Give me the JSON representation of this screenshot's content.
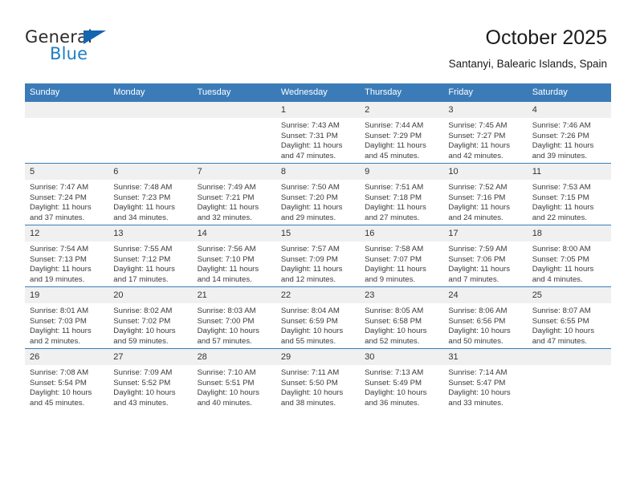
{
  "brand": {
    "line1": "General",
    "line2": "Blue",
    "flag_icon": "blue-triangle-flag-icon",
    "colors": {
      "general": "#2b2b2b",
      "blue": "#1f7ec4",
      "flag": "#1565b0"
    }
  },
  "header": {
    "month_title": "October 2025",
    "location": "Santanyi, Balearic Islands, Spain"
  },
  "theme": {
    "header_row_background": "#3b7cb8",
    "header_row_text": "#ffffff",
    "daynum_background": "#f0f0f0",
    "row_separator": "#3b7cb8",
    "body_text": "#3a3a3a"
  },
  "labels": {
    "sunrise_prefix": "Sunrise:",
    "sunset_prefix": "Sunset:",
    "daylight_prefix": "Daylight:"
  },
  "columns": [
    "Sunday",
    "Monday",
    "Tuesday",
    "Wednesday",
    "Thursday",
    "Friday",
    "Saturday"
  ],
  "weeks": [
    [
      {
        "day": "",
        "empty": true
      },
      {
        "day": "",
        "empty": true
      },
      {
        "day": "",
        "empty": true
      },
      {
        "day": "1",
        "sunrise": "Sunrise: 7:43 AM",
        "sunset": "Sunset: 7:31 PM",
        "daylight": "Daylight: 11 hours and 47 minutes."
      },
      {
        "day": "2",
        "sunrise": "Sunrise: 7:44 AM",
        "sunset": "Sunset: 7:29 PM",
        "daylight": "Daylight: 11 hours and 45 minutes."
      },
      {
        "day": "3",
        "sunrise": "Sunrise: 7:45 AM",
        "sunset": "Sunset: 7:27 PM",
        "daylight": "Daylight: 11 hours and 42 minutes."
      },
      {
        "day": "4",
        "sunrise": "Sunrise: 7:46 AM",
        "sunset": "Sunset: 7:26 PM",
        "daylight": "Daylight: 11 hours and 39 minutes."
      }
    ],
    [
      {
        "day": "5",
        "sunrise": "Sunrise: 7:47 AM",
        "sunset": "Sunset: 7:24 PM",
        "daylight": "Daylight: 11 hours and 37 minutes."
      },
      {
        "day": "6",
        "sunrise": "Sunrise: 7:48 AM",
        "sunset": "Sunset: 7:23 PM",
        "daylight": "Daylight: 11 hours and 34 minutes."
      },
      {
        "day": "7",
        "sunrise": "Sunrise: 7:49 AM",
        "sunset": "Sunset: 7:21 PM",
        "daylight": "Daylight: 11 hours and 32 minutes."
      },
      {
        "day": "8",
        "sunrise": "Sunrise: 7:50 AM",
        "sunset": "Sunset: 7:20 PM",
        "daylight": "Daylight: 11 hours and 29 minutes."
      },
      {
        "day": "9",
        "sunrise": "Sunrise: 7:51 AM",
        "sunset": "Sunset: 7:18 PM",
        "daylight": "Daylight: 11 hours and 27 minutes."
      },
      {
        "day": "10",
        "sunrise": "Sunrise: 7:52 AM",
        "sunset": "Sunset: 7:16 PM",
        "daylight": "Daylight: 11 hours and 24 minutes."
      },
      {
        "day": "11",
        "sunrise": "Sunrise: 7:53 AM",
        "sunset": "Sunset: 7:15 PM",
        "daylight": "Daylight: 11 hours and 22 minutes."
      }
    ],
    [
      {
        "day": "12",
        "sunrise": "Sunrise: 7:54 AM",
        "sunset": "Sunset: 7:13 PM",
        "daylight": "Daylight: 11 hours and 19 minutes."
      },
      {
        "day": "13",
        "sunrise": "Sunrise: 7:55 AM",
        "sunset": "Sunset: 7:12 PM",
        "daylight": "Daylight: 11 hours and 17 minutes."
      },
      {
        "day": "14",
        "sunrise": "Sunrise: 7:56 AM",
        "sunset": "Sunset: 7:10 PM",
        "daylight": "Daylight: 11 hours and 14 minutes."
      },
      {
        "day": "15",
        "sunrise": "Sunrise: 7:57 AM",
        "sunset": "Sunset: 7:09 PM",
        "daylight": "Daylight: 11 hours and 12 minutes."
      },
      {
        "day": "16",
        "sunrise": "Sunrise: 7:58 AM",
        "sunset": "Sunset: 7:07 PM",
        "daylight": "Daylight: 11 hours and 9 minutes."
      },
      {
        "day": "17",
        "sunrise": "Sunrise: 7:59 AM",
        "sunset": "Sunset: 7:06 PM",
        "daylight": "Daylight: 11 hours and 7 minutes."
      },
      {
        "day": "18",
        "sunrise": "Sunrise: 8:00 AM",
        "sunset": "Sunset: 7:05 PM",
        "daylight": "Daylight: 11 hours and 4 minutes."
      }
    ],
    [
      {
        "day": "19",
        "sunrise": "Sunrise: 8:01 AM",
        "sunset": "Sunset: 7:03 PM",
        "daylight": "Daylight: 11 hours and 2 minutes."
      },
      {
        "day": "20",
        "sunrise": "Sunrise: 8:02 AM",
        "sunset": "Sunset: 7:02 PM",
        "daylight": "Daylight: 10 hours and 59 minutes."
      },
      {
        "day": "21",
        "sunrise": "Sunrise: 8:03 AM",
        "sunset": "Sunset: 7:00 PM",
        "daylight": "Daylight: 10 hours and 57 minutes."
      },
      {
        "day": "22",
        "sunrise": "Sunrise: 8:04 AM",
        "sunset": "Sunset: 6:59 PM",
        "daylight": "Daylight: 10 hours and 55 minutes."
      },
      {
        "day": "23",
        "sunrise": "Sunrise: 8:05 AM",
        "sunset": "Sunset: 6:58 PM",
        "daylight": "Daylight: 10 hours and 52 minutes."
      },
      {
        "day": "24",
        "sunrise": "Sunrise: 8:06 AM",
        "sunset": "Sunset: 6:56 PM",
        "daylight": "Daylight: 10 hours and 50 minutes."
      },
      {
        "day": "25",
        "sunrise": "Sunrise: 8:07 AM",
        "sunset": "Sunset: 6:55 PM",
        "daylight": "Daylight: 10 hours and 47 minutes."
      }
    ],
    [
      {
        "day": "26",
        "sunrise": "Sunrise: 7:08 AM",
        "sunset": "Sunset: 5:54 PM",
        "daylight": "Daylight: 10 hours and 45 minutes."
      },
      {
        "day": "27",
        "sunrise": "Sunrise: 7:09 AM",
        "sunset": "Sunset: 5:52 PM",
        "daylight": "Daylight: 10 hours and 43 minutes."
      },
      {
        "day": "28",
        "sunrise": "Sunrise: 7:10 AM",
        "sunset": "Sunset: 5:51 PM",
        "daylight": "Daylight: 10 hours and 40 minutes."
      },
      {
        "day": "29",
        "sunrise": "Sunrise: 7:11 AM",
        "sunset": "Sunset: 5:50 PM",
        "daylight": "Daylight: 10 hours and 38 minutes."
      },
      {
        "day": "30",
        "sunrise": "Sunrise: 7:13 AM",
        "sunset": "Sunset: 5:49 PM",
        "daylight": "Daylight: 10 hours and 36 minutes."
      },
      {
        "day": "31",
        "sunrise": "Sunrise: 7:14 AM",
        "sunset": "Sunset: 5:47 PM",
        "daylight": "Daylight: 10 hours and 33 minutes."
      },
      {
        "day": "",
        "empty": true
      }
    ]
  ]
}
